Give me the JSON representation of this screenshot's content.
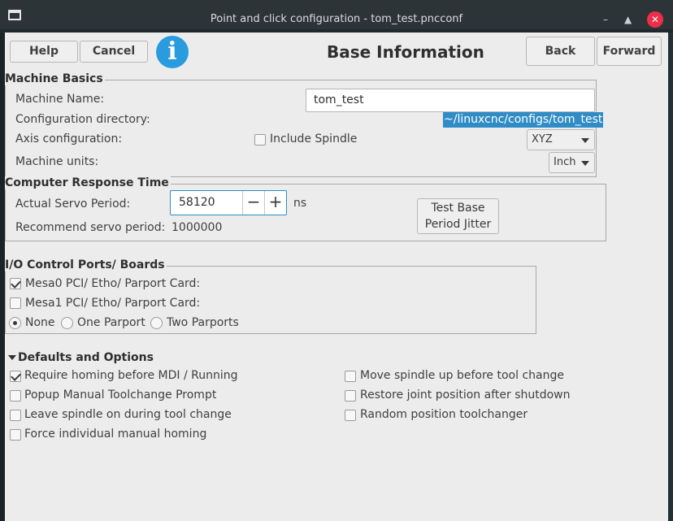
{
  "window": {
    "title": "Point and click configuration - tom_test.pncconf",
    "minimize_glyph": "–",
    "maximize_glyph": "▲",
    "close_glyph": "✕"
  },
  "toolbar": {
    "help_label": "Help",
    "cancel_label": "Cancel",
    "back_label": "Back",
    "forward_label": "Forward",
    "info_glyph": "i"
  },
  "page_title": "Base Information",
  "machine_basics": {
    "title": "Machine Basics",
    "name_label": "Machine Name:",
    "name_value": "tom_test",
    "config_dir_label": "Configuration directory:",
    "config_dir_value": "~/linuxcnc/configs/tom_test",
    "axis_label": "Axis configuration:",
    "include_spindle_label": "Include Spindle",
    "include_spindle_checked": false,
    "axis_value": "XYZ",
    "units_label": "Machine units:",
    "units_value": "Inch"
  },
  "response_time": {
    "title": "Computer Response Time",
    "servo_label": "Actual Servo Period:",
    "servo_value": "58120",
    "minus_glyph": "−",
    "plus_glyph": "+",
    "servo_unit": "ns",
    "recommend_label": "Recommend servo period:",
    "recommend_value": "1000000",
    "test_button_line1": "Test Base",
    "test_button_line2": "Period Jitter"
  },
  "io_ports": {
    "title": "I/O Control Ports/ Boards",
    "mesa0_label": "Mesa0 PCI/ Etho/ Parport Card:",
    "mesa0_checked": true,
    "mesa1_label": "Mesa1 PCI/ Etho/ Parport Card:",
    "mesa1_checked": false,
    "parport_options": [
      "None",
      "One Parport",
      "Two Parports"
    ],
    "parport_selected": "None"
  },
  "defaults": {
    "title": "Defaults and Options",
    "left_options": [
      {
        "label": "Require homing before MDI / Running",
        "checked": true
      },
      {
        "label": "Popup Manual Toolchange Prompt",
        "checked": false
      },
      {
        "label": "Leave spindle on during tool change",
        "checked": false
      },
      {
        "label": "Force individual manual homing",
        "checked": false
      }
    ],
    "right_options": [
      {
        "label": "Move spindle up before tool change",
        "checked": false
      },
      {
        "label": "Restore joint position after shutdown",
        "checked": false
      },
      {
        "label": "Random position toolchanger",
        "checked": false
      }
    ]
  }
}
